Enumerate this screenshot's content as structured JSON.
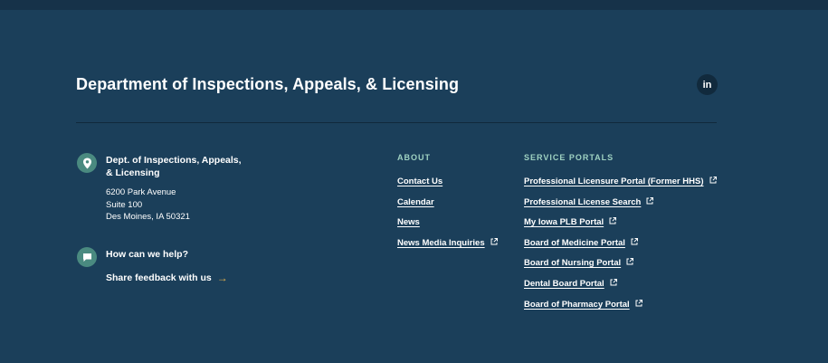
{
  "footer": {
    "org_title": "Department of Inspections, Appeals, & Licensing",
    "social": {
      "linkedin_label": "in"
    },
    "address": {
      "name": "Dept. of Inspections, Appeals, & Licensing",
      "line1": "6200 Park Avenue",
      "line2": "Suite 100",
      "line3": "Des Moines, IA 50321"
    },
    "help": {
      "title": "How can we help?",
      "feedback_label": "Share feedback with us",
      "arrow": "→"
    },
    "about": {
      "heading": "ABOUT",
      "links": [
        {
          "label": "Contact Us",
          "external": false
        },
        {
          "label": "Calendar",
          "external": false
        },
        {
          "label": "News",
          "external": false
        },
        {
          "label": "News Media Inquiries",
          "external": true
        }
      ]
    },
    "service_portals": {
      "heading": "SERVICE PORTALS",
      "links": [
        {
          "label": "Professional Licensure Portal (Former HHS)",
          "external": true
        },
        {
          "label": "Professional License Search",
          "external": true
        },
        {
          "label": "My Iowa PLB Portal",
          "external": true
        },
        {
          "label": "Board of Medicine Portal",
          "external": true
        },
        {
          "label": "Board of Nursing Portal",
          "external": true
        },
        {
          "label": "Dental Board Portal",
          "external": true
        },
        {
          "label": "Board of Pharmacy Portal",
          "external": true
        }
      ]
    },
    "colors": {
      "background": "#1b3f5a",
      "accent_icon": "#4a8a80",
      "heading": "#9fd2c2",
      "arrow": "#e9b54e"
    }
  }
}
